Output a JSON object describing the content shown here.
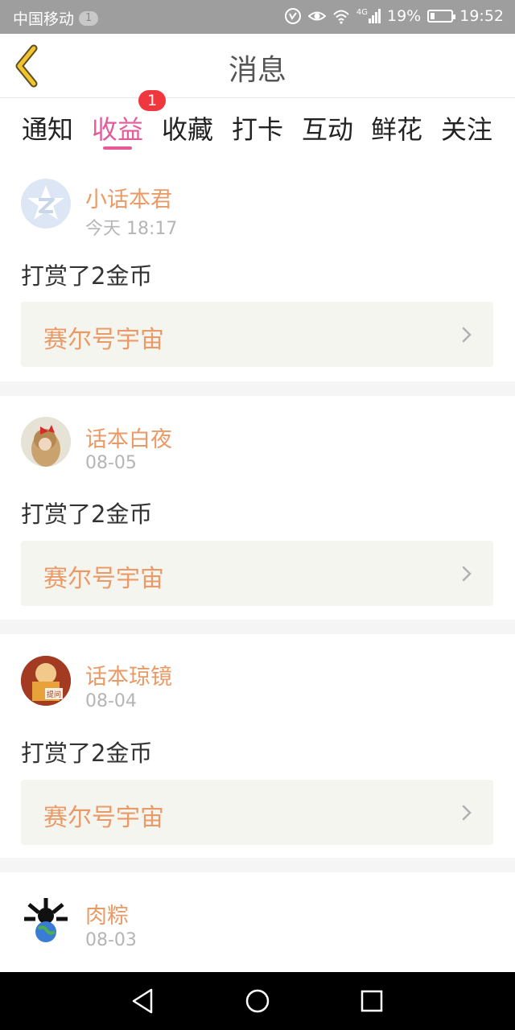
{
  "status_bar": {
    "carrier": "中国移动",
    "sim": "1",
    "network": "4G",
    "battery": "19%",
    "battery_fraction": 0.19,
    "time": "19:52"
  },
  "header": {
    "title": "消息",
    "back_icon": "chevron-left-icon"
  },
  "tabs": {
    "items": [
      "通知",
      "收益",
      "收藏",
      "打卡",
      "互动",
      "鲜花",
      "关注"
    ],
    "active": "收益",
    "badge": "1"
  },
  "messages": [
    {
      "name": "小话本君",
      "time": "今天 18:17",
      "text": "打赏了2金币",
      "ref": "赛尔号宇宙"
    },
    {
      "name": "话本白夜",
      "time": "08-05",
      "text": "打赏了2金币",
      "ref": "赛尔号宇宙"
    },
    {
      "name": "话本琼镜",
      "time": "08-04",
      "text": "打赏了2金币",
      "ref": "赛尔号宇宙"
    },
    {
      "name": "肉粽",
      "time": "08-03"
    }
  ],
  "colors": {
    "accent": "#e55b9a",
    "name": "#ea9a66",
    "badge": "#f0373d",
    "status_bar": "#9e9e9e"
  },
  "navbar": {
    "icons": [
      "back-triangle-icon",
      "home-circle-icon",
      "recents-square-icon"
    ]
  }
}
